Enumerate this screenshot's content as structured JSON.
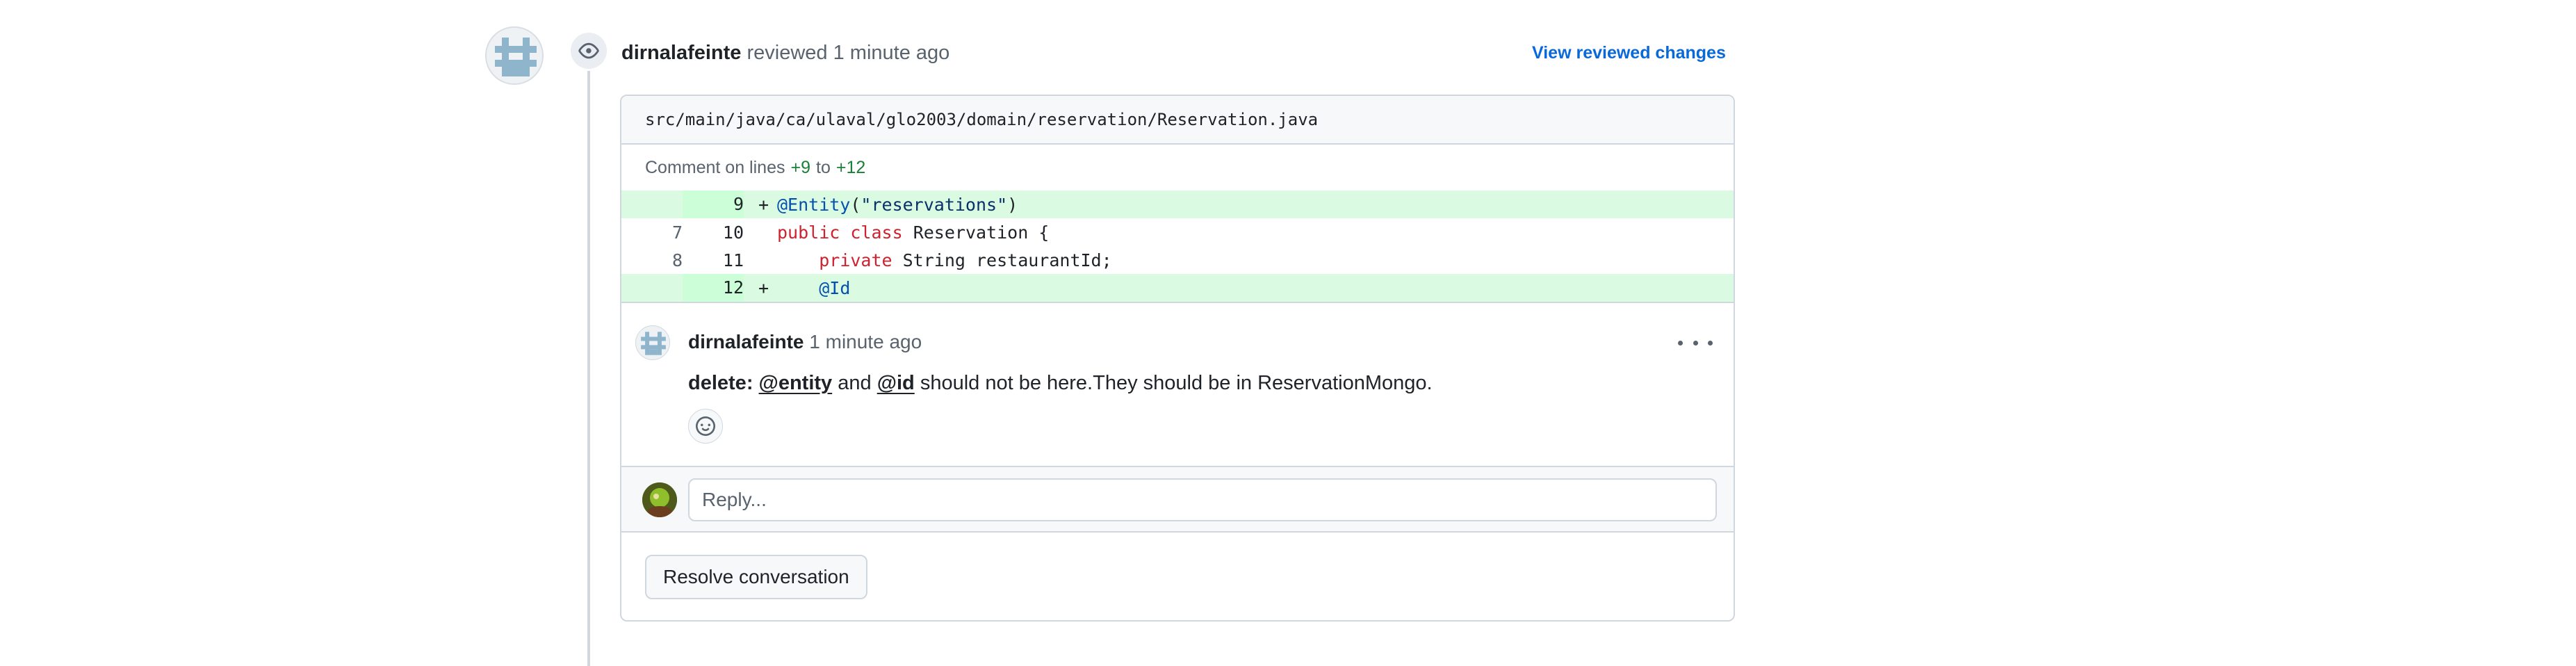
{
  "review": {
    "author": "dirnalafeinte",
    "action": "reviewed",
    "time": "1 minute ago",
    "view_changes_label": "View reviewed changes"
  },
  "file": {
    "path": "src/main/java/ca/ulaval/glo2003/domain/reservation/Reservation.java",
    "comment_prefix": "Comment on lines",
    "line_start": "+9",
    "line_to": "to",
    "line_end": "+12"
  },
  "diff": [
    {
      "old": "",
      "new": "9",
      "sign": "+",
      "added": true
    },
    {
      "old": "7",
      "new": "10",
      "sign": "",
      "added": false
    },
    {
      "old": "8",
      "new": "11",
      "sign": "",
      "added": false
    },
    {
      "old": "",
      "new": "12",
      "sign": "+",
      "added": true
    }
  ],
  "code": {
    "l1_ann": "@Entity",
    "l1_paren_open": "(",
    "l1_str": "\"reservations\"",
    "l1_paren_close": ")",
    "l2_kw1": "public",
    "l2_kw2": "class",
    "l2_rest": " Reservation {",
    "l3_indent": "    ",
    "l3_kw": "private",
    "l3_rest": " String restaurantId;",
    "l4_indent": "    ",
    "l4_ann": "@Id"
  },
  "comment": {
    "author": "dirnalafeinte",
    "time": "1 minute ago",
    "prefix": "delete:",
    "mention1": "@entity",
    "and": "and",
    "mention2": "@id",
    "rest": "should not be here.They should be in ReservationMongo."
  },
  "reply": {
    "placeholder": "Reply..."
  },
  "resolve_label": "Resolve conversation",
  "icons": {
    "eye": "eye-icon",
    "kebab": "kebab-horizontal-icon",
    "smiley": "smiley-icon",
    "identicon": "identicon-avatar"
  },
  "colors": {
    "link": "#0969da",
    "added_bg": "#dafbe1",
    "keyword": "#cf222e",
    "annotation": "#0550ae",
    "string": "#0a3069"
  }
}
